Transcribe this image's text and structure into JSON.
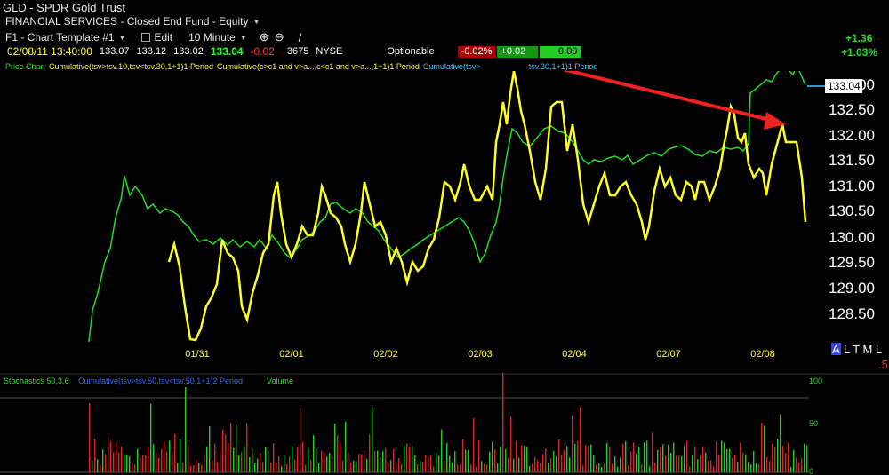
{
  "header": {
    "symbol": "GLD",
    "separator": " - ",
    "name": "SPDR Gold Trust",
    "sector": "FINANCIAL SERVICES - Closed End Fund - Equity"
  },
  "toolbar": {
    "template": "F1 - Chart Template #1",
    "edit": "Edit",
    "interval": "10 Minute"
  },
  "quote": {
    "datetime": "02/08/11 13:40:00",
    "open": "133.07",
    "high": "133.12",
    "low": "133.02",
    "last": "133.04",
    "change": "-0.02",
    "volume": "3675",
    "exchange": "NYSE",
    "optionable": "Optionable",
    "box_red": "-0.02%",
    "box_green1": "+0.02",
    "box_green2": "0.00",
    "day_change": "+1.36",
    "day_change_pct": "+1.03%"
  },
  "studies": {
    "price_label": "Price Chart",
    "cum1": "Cumulative(tsv>tsv.10,tsv<tsv.30,1+1)1 Period",
    "cum2": "Cumulative(c>c1 and v>a...,c<c1 and v>a...,1+1)1 Period",
    "cum3_prefix": "Cumulative(tsv>",
    "cum3_suffix": "tsv.30,1+1)1 Period",
    "stoch_label": "Stochastics 50,3,6",
    "stoch_cum": "Cumulative(tsv>tsv.50,tsv<tsv.50,1+1)2 Period",
    "volume_label": "Volume"
  },
  "price_axis": {
    "labels": [
      "133.00",
      "132.50",
      "132.00",
      "131.50",
      "131.00",
      "130.50",
      "130.00",
      "129.50",
      "129.00",
      "128.50"
    ],
    "current": "133.04"
  },
  "date_labels": [
    "01/31",
    "02/01",
    "02/02",
    "02/03",
    "02/04",
    "02/07",
    "02/08"
  ],
  "stoch_axis": [
    "100",
    "50",
    "0"
  ],
  "corner": {
    "a": "A",
    "rest": "L T M L",
    "mark": ".5"
  },
  "colors": {
    "price_line": "#22dd22",
    "indicator_line": "#ffff22",
    "arrow": "#ee2222",
    "volume_up": "#22cc22",
    "volume_down": "#dd2222"
  }
}
